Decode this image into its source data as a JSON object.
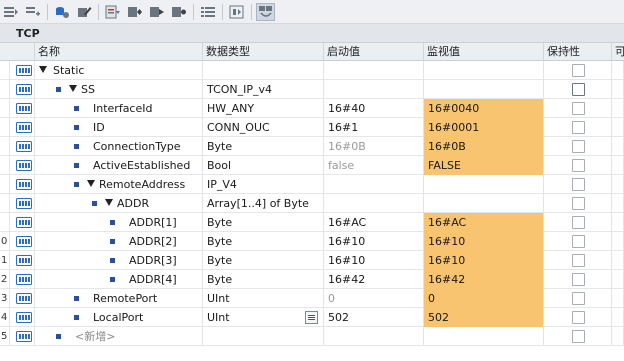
{
  "toolbar": {
    "buttons": [
      {
        "name": "insert-row-icon"
      },
      {
        "name": "add-row-icon"
      },
      {
        "name": "db-settings-icon"
      },
      {
        "name": "edit-icon"
      },
      {
        "name": "monitor-snapshot-icon"
      },
      {
        "name": "copy-snapshot-icon"
      },
      {
        "name": "load-start-values-icon"
      },
      {
        "name": "set-start-values-icon"
      },
      {
        "name": "list-view-icon"
      },
      {
        "name": "expand-icon"
      },
      {
        "name": "monitor-all-icon"
      }
    ]
  },
  "block_title": "TCP",
  "headers": {
    "name": "名称",
    "datatype": "数据类型",
    "start_value": "启动值",
    "monitor_value": "监视值",
    "retain": "保持性",
    "extra": "可"
  },
  "rows": [
    {
      "num": "",
      "name": "Static",
      "type": "",
      "start": "",
      "monitor": "",
      "indent": 0,
      "expand": true,
      "bullet": false,
      "highlight": false
    },
    {
      "num": "",
      "name": "SS",
      "type": "TCON_IP_v4",
      "start": "",
      "monitor": "",
      "indent": 1,
      "expand": true,
      "bullet": true,
      "highlight": false
    },
    {
      "num": "",
      "name": "InterfaceId",
      "type": "HW_ANY",
      "start": "16#40",
      "monitor": "16#0040",
      "indent": 2,
      "expand": false,
      "bullet": true,
      "highlight": true
    },
    {
      "num": "",
      "name": "ID",
      "type": "CONN_OUC",
      "start": "16#1",
      "monitor": "16#0001",
      "indent": 2,
      "expand": false,
      "bullet": true,
      "highlight": true
    },
    {
      "num": "",
      "name": "ConnectionType",
      "type": "Byte",
      "start": "16#0B",
      "monitor": "16#0B",
      "indent": 2,
      "expand": false,
      "bullet": true,
      "highlight": true,
      "start_dim": true
    },
    {
      "num": "",
      "name": "ActiveEstablished",
      "type": "Bool",
      "start": "false",
      "monitor": "FALSE",
      "indent": 2,
      "expand": false,
      "bullet": true,
      "highlight": true,
      "start_dim": true
    },
    {
      "num": "",
      "name": "RemoteAddress",
      "type": "IP_V4",
      "start": "",
      "monitor": "",
      "indent": 2,
      "expand": true,
      "bullet": true,
      "highlight": false
    },
    {
      "num": "",
      "name": "ADDR",
      "type": "Array[1..4] of Byte",
      "start": "",
      "monitor": "",
      "indent": 3,
      "expand": true,
      "bullet": true,
      "highlight": false
    },
    {
      "num": "",
      "name": "ADDR[1]",
      "type": "Byte",
      "start": "16#AC",
      "monitor": "16#AC",
      "indent": 4,
      "expand": false,
      "bullet": true,
      "highlight": true
    },
    {
      "num": "0",
      "name": "ADDR[2]",
      "type": "Byte",
      "start": "16#10",
      "monitor": "16#10",
      "indent": 4,
      "expand": false,
      "bullet": true,
      "highlight": true
    },
    {
      "num": "1",
      "name": "ADDR[3]",
      "type": "Byte",
      "start": "16#10",
      "monitor": "16#10",
      "indent": 4,
      "expand": false,
      "bullet": true,
      "highlight": true
    },
    {
      "num": "2",
      "name": "ADDR[4]",
      "type": "Byte",
      "start": "16#42",
      "monitor": "16#42",
      "indent": 4,
      "expand": false,
      "bullet": true,
      "highlight": true
    },
    {
      "num": "3",
      "name": "RemotePort",
      "type": "UInt",
      "start": "0",
      "monitor": "0",
      "indent": 2,
      "expand": false,
      "bullet": true,
      "highlight": true,
      "start_dim": true
    },
    {
      "num": "4",
      "name": "LocalPort",
      "type": "UInt",
      "start": "502",
      "monitor": "502",
      "indent": 2,
      "expand": false,
      "bullet": true,
      "highlight": true,
      "picker": true
    },
    {
      "num": "5",
      "name": "<新增>",
      "type": "",
      "start": "",
      "monitor": "",
      "indent": 1,
      "expand": false,
      "bullet": true,
      "highlight": false,
      "add_new": true
    }
  ],
  "colors": {
    "highlight": "#f9c46f",
    "icon_blue": "#2b6cc4",
    "bullet": "#2b4f9a"
  }
}
